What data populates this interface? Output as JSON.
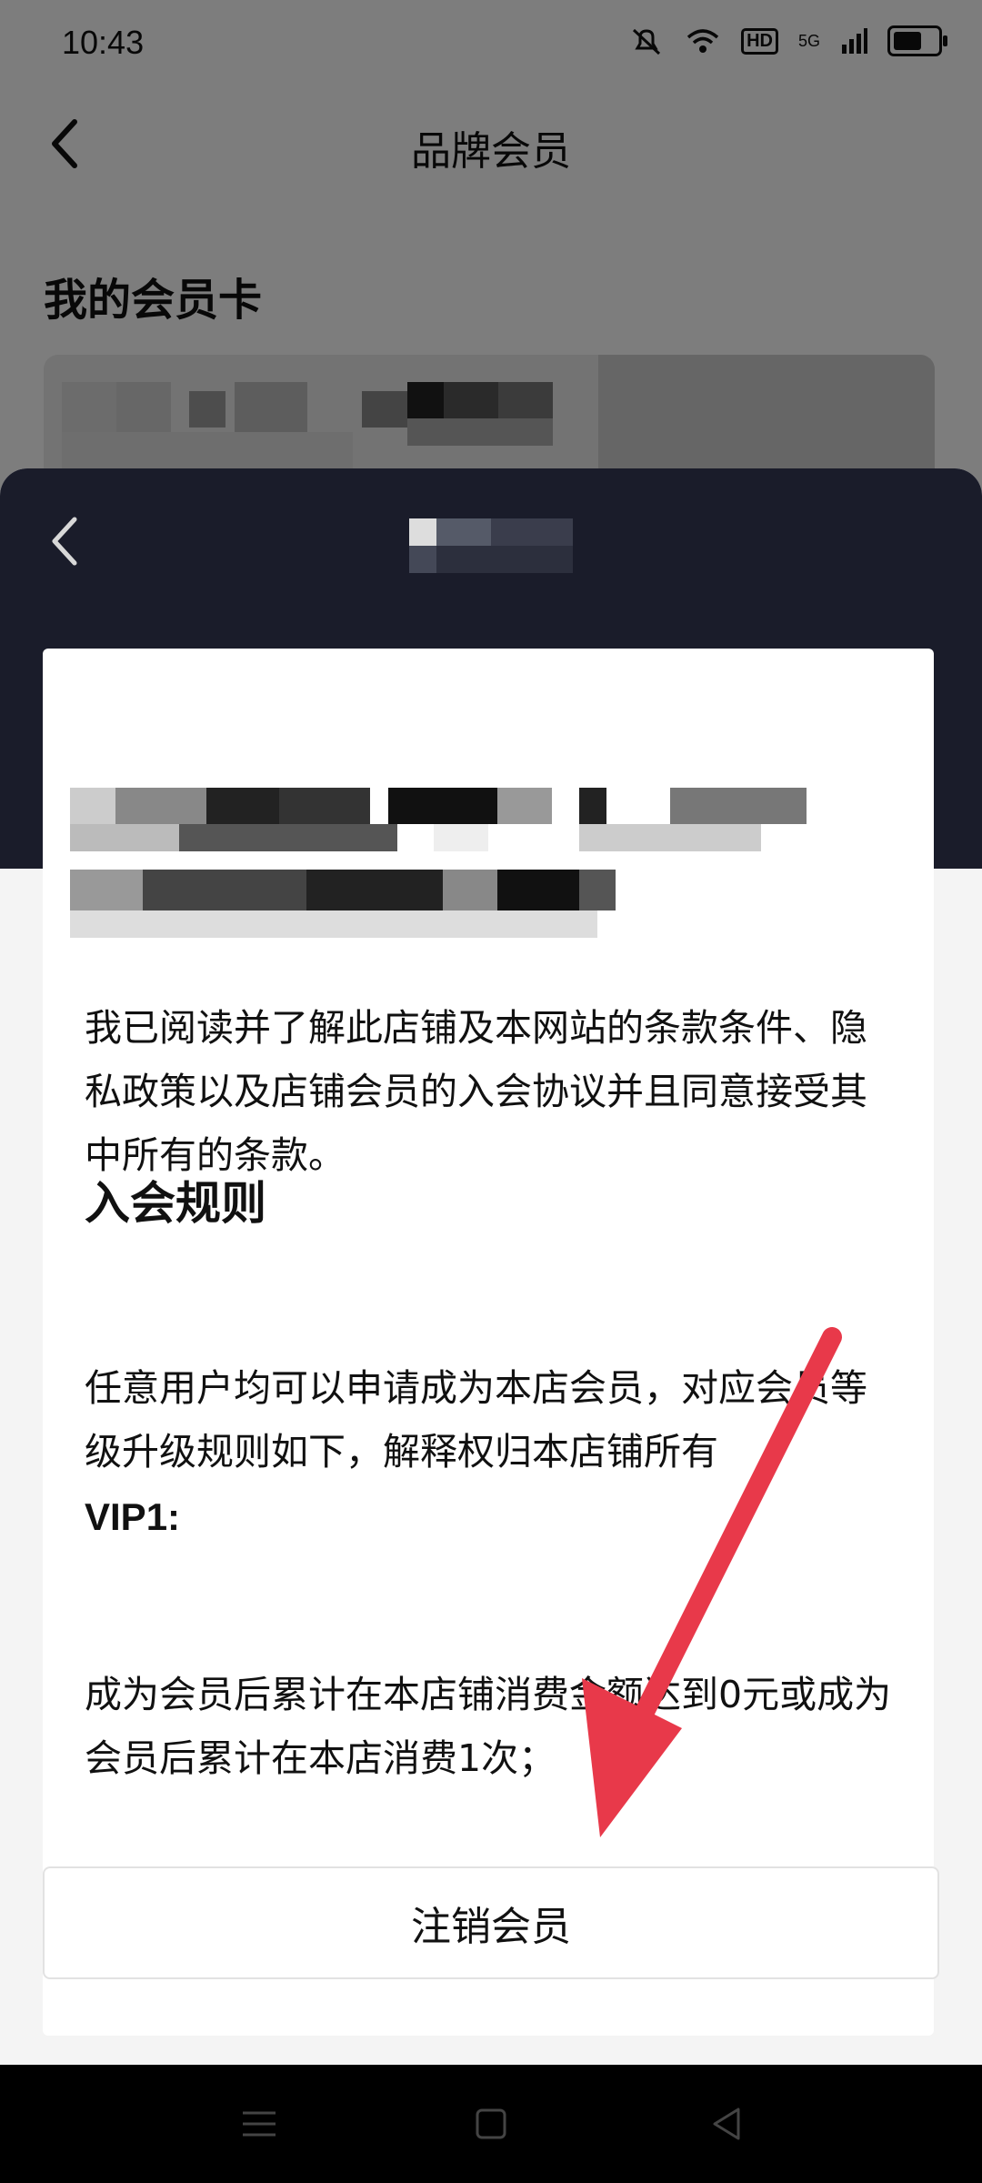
{
  "status_bar": {
    "time": "10:43",
    "hd_label": "HD",
    "network_label": "5G"
  },
  "background_page": {
    "title": "品牌会员",
    "section_title": "我的会员卡"
  },
  "agreement": {
    "consent_text": "我已阅读并了解此店铺及本网站的条款条件、隐私政策以及店铺会员的入会协议并且同意接受其中所有的条款。",
    "rules_heading": "入会规则",
    "rules_text": "任意用户均可以申请成为本店会员，对应会员等级升级规则如下，解释权归本店铺所有",
    "vip1_label": "VIP1:",
    "vip1_text": "成为会员后累计在本店铺消费金额达到0元或成为会员后累计在本店消费1次；"
  },
  "actions": {
    "cancel_membership_label": "注销会员"
  },
  "colors": {
    "sheet_header": "#1a1c2a",
    "annotation_arrow": "#e8394a"
  },
  "icons": {
    "back": "chevron-left-icon",
    "nav_menu": "menu-icon",
    "nav_home": "square-icon",
    "nav_back": "triangle-back-icon"
  }
}
